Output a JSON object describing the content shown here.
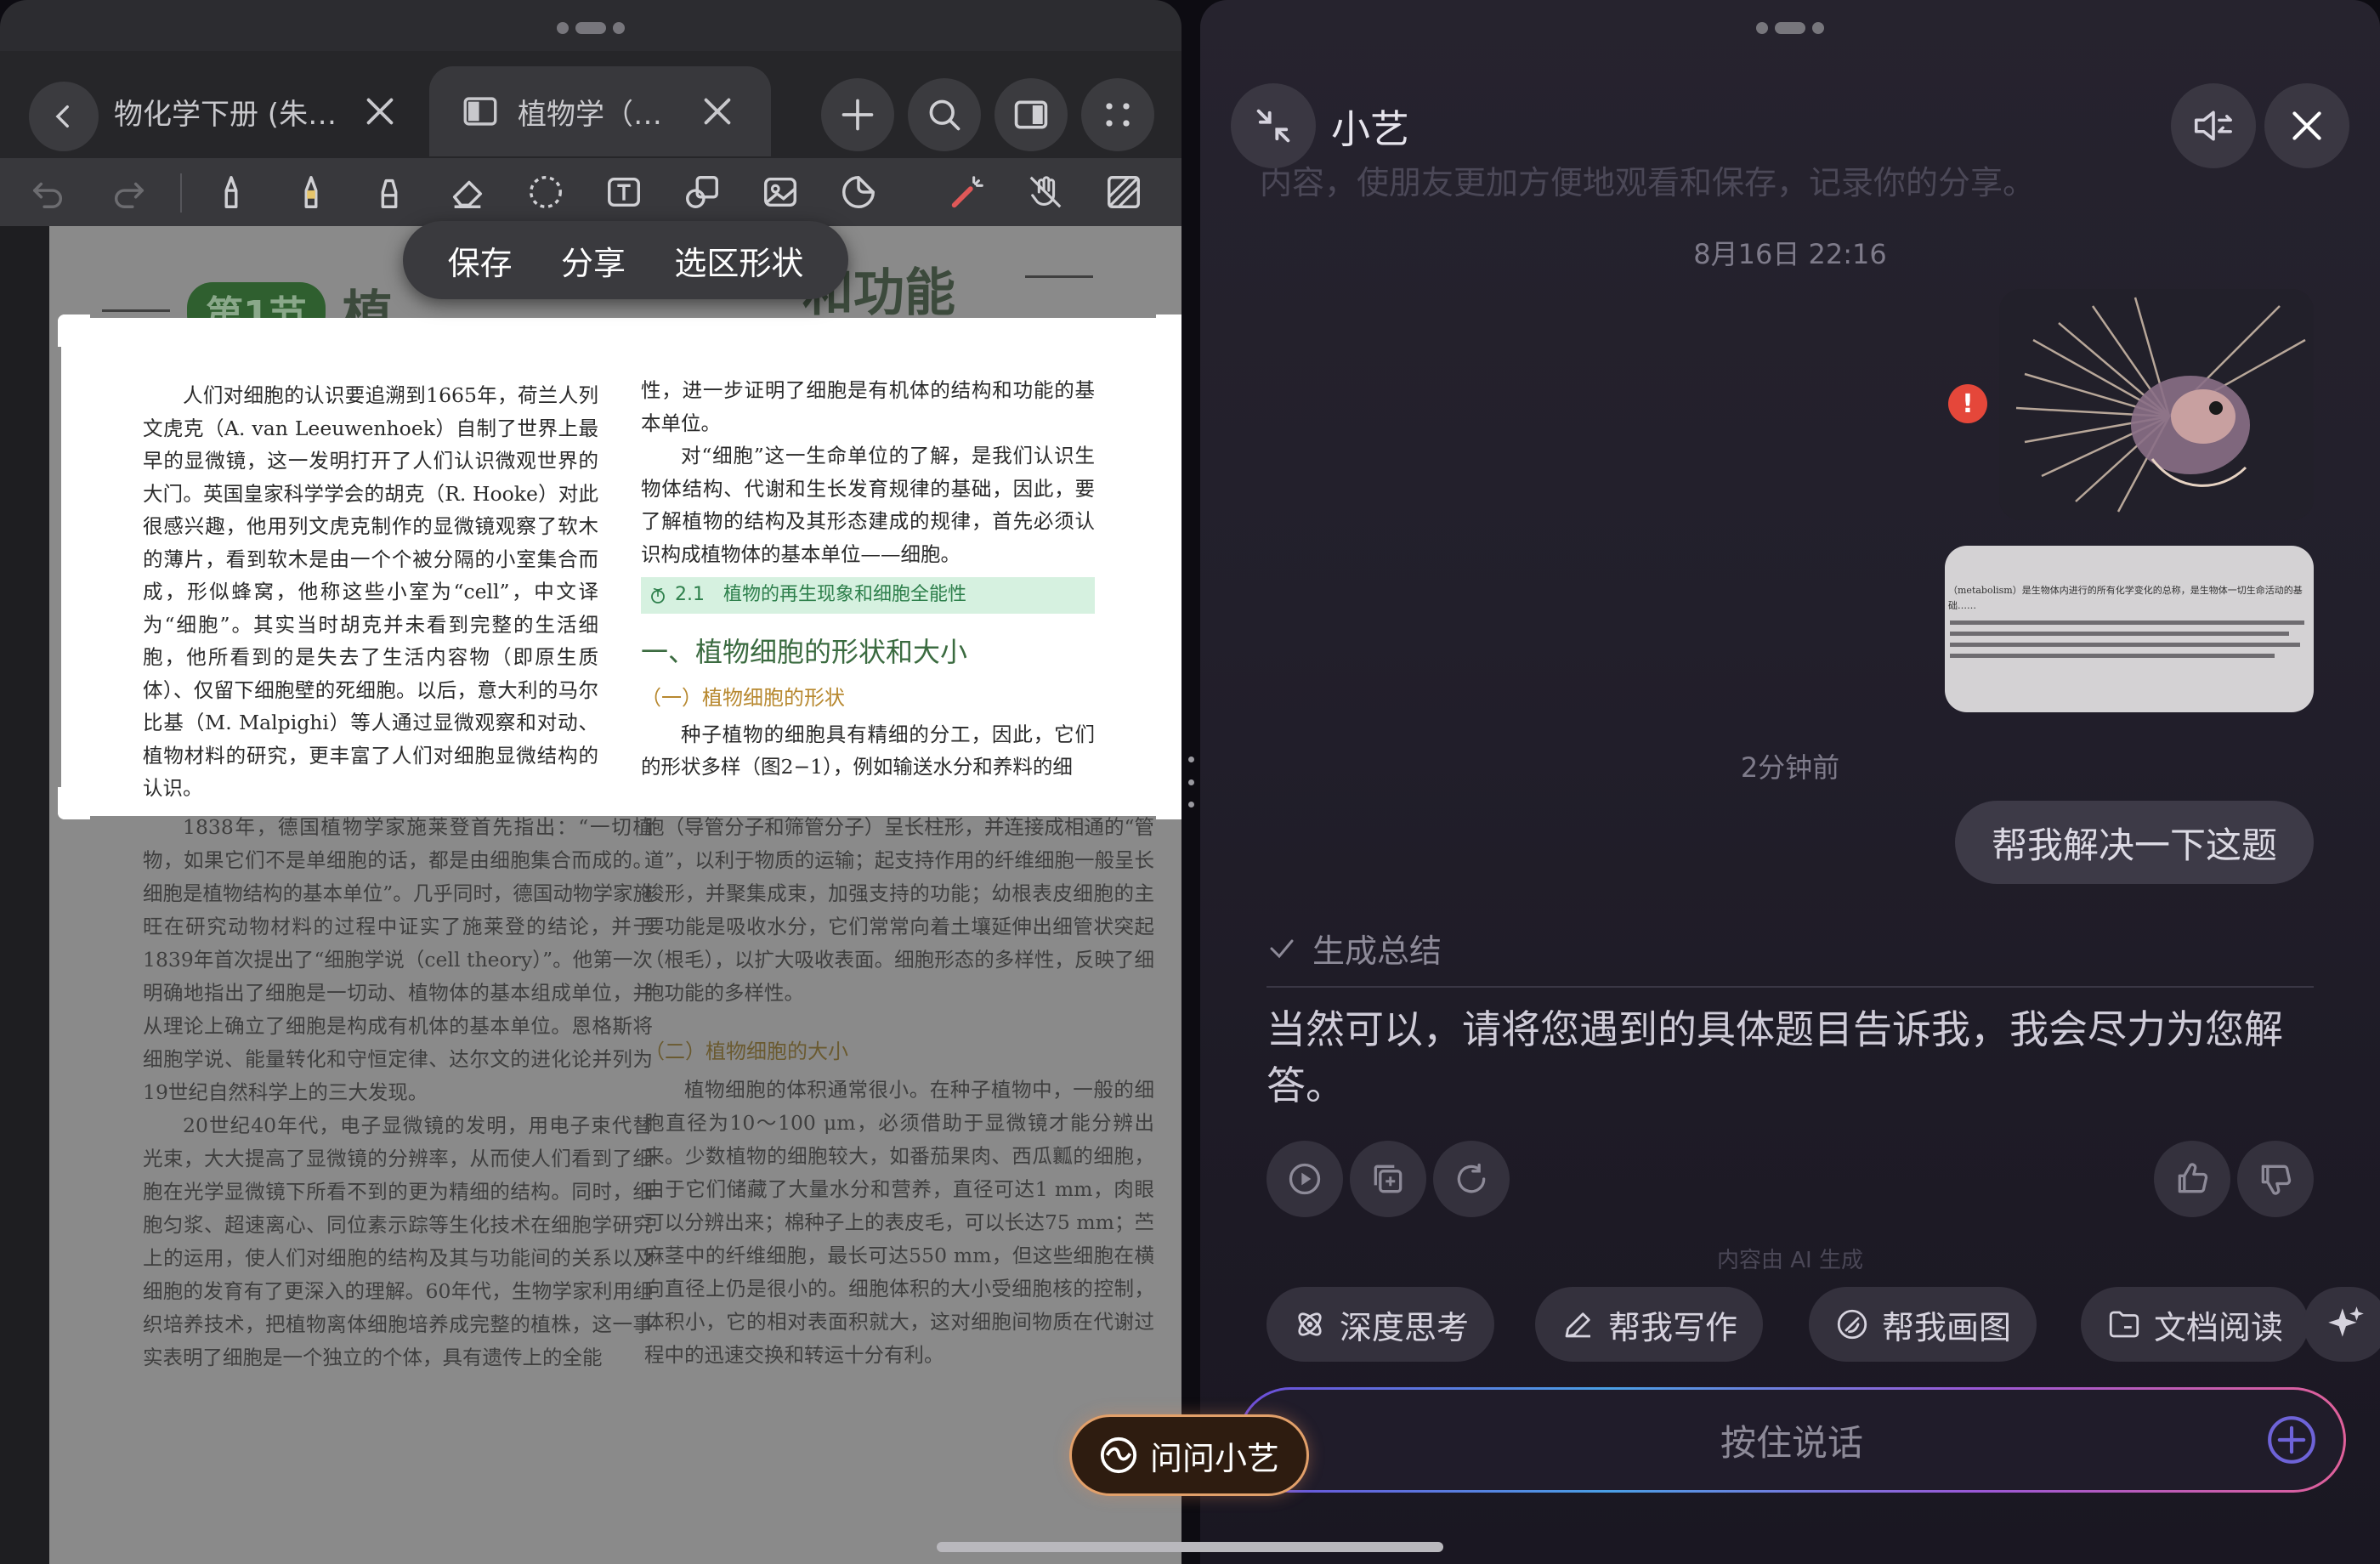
{
  "left_panel": {
    "tabs": [
      {
        "label": "物化学下册 (朱…"
      },
      {
        "label": "植物学（…"
      }
    ],
    "selection_menu": {
      "save": "保存",
      "share": "分享",
      "shape": "选区形状"
    },
    "section": {
      "badge": "第1节",
      "title_left": "植",
      "title_right": "和功能"
    },
    "selected_content": {
      "left_col": "人们对细胞的认识要追溯到1665年，荷兰人列文虎克（A. van Leeuwenhoek）自制了世界上最早的显微镜，这一发明打开了人们认识微观世界的大门。英国皇家科学学会的胡克（R. Hooke）对此很感兴趣，他用列文虎克制作的显微镜观察了软木的薄片，看到软木是由一个个被分隔的小室集合而成，形似蜂窝，他称这些小室为“cell”，中文译为“细胞”。其实当时胡克并未看到完整的生活细胞，他所看到的是失去了生活内容物（即原生质体）、仅留下细胞壁的死细胞。以后，意大利的马尔比基（M. Malpighi）等人通过显微观察和对动、植物材料的研究，更丰富了人们对细胞显微结构的认识。",
      "right_col_p1": "性，进一步证明了细胞是有机体的结构和功能的基本单位。",
      "right_col_p2": "对“细胞”这一生命单位的了解，是我们认识生物体结构、代谢和生长发育规律的基础，因此，要了解植物的结构及其形态建成的规律，首先必须认识构成植物体的基本单位——细胞。",
      "figure_ref": "2.1　植物的再生现象和细胞全能性",
      "heading": "一、植物细胞的形状和大小",
      "subheading": "（一）植物细胞的形状",
      "right_col_p3": "种子植物的细胞具有精细的分工，因此，它们的形状多样（图2−1），例如输送水分和养料的细"
    },
    "dim_content": {
      "left_p1": "1838年，德国植物学家施莱登首先指出：“一切植物，如果它们不是单细胞的话，都是由细胞集合而成的。细胞是植物结构的基本单位”。几乎同时，德国动物学家施旺在研究动物材料的过程中证实了施莱登的结论，并于1839年首次提出了“细胞学说（cell theory）”。他第一次明确地指出了细胞是一切动、植物体的基本组成单位，并从理论上确立了细胞是构成有机体的基本单位。恩格斯将细胞学说、能量转化和守恒定律、达尔文的进化论并列为19世纪自然科学上的三大发现。",
      "left_p2": "20世纪40年代，电子显微镜的发明，用电子束代替光束，大大提高了显微镜的分辨率，从而使人们看到了细胞在光学显微镜下所看不到的更为精细的结构。同时，细胞匀浆、超速离心、同位素示踪等生化技术在细胞学研究上的运用，使人们对细胞的结构及其与功能间的关系以及细胞的发育有了更深入的理解。60年代，生物学家利用组织培养技术，把植物离体细胞培养成完整的植株，这一事实表明了细胞是一个独立的个体，具有遗传上的全能",
      "right_p1": "胞（导管分子和筛管分子）呈长柱形，并连接成相通的“管道”，以利于物质的运输；起支持作用的纤维细胞一般呈长梭形，并聚集成束，加强支持的功能；幼根表皮细胞的主要功能是吸收水分，它们常常向着土壤延伸出细管状突起（根毛），以扩大吸收表面。细胞形态的多样性，反映了细胞功能的多样性。",
      "right_sub": "（二）植物细胞的大小",
      "right_p2": "植物细胞的体积通常很小。在种子植物中，一般的细胞直径为10～100 μm，必须借助于显微镜才能分辨出来。少数植物的细胞较大，如番茄果肉、西瓜瓤的细胞，由于它们储藏了大量水分和营养，直径可达1 mm，肉眼可以分辨出来；棉种子上的表皮毛，可以长达75 mm；苎麻茎中的纤维细胞，最长可达550 mm，但这些细胞在横向直径上仍是很小的。细胞体积的大小受细胞核的控制，体积小，它的相对表面积就大，这对细胞间物质在代谢过程中的迅速交换和转运十分有利。"
    },
    "ask_button": "问问小艺"
  },
  "right_panel": {
    "title": "小艺",
    "faint_line": "内容，使朋友更加方便地观看和保存，记录你的分享。",
    "timestamp1": "8月16日 22:16",
    "thumb2_text": "（metabolism）是生物体内进行的所有化学变化的总称，是生物体一切生命活动的基础……",
    "timestamp2": "2分钟前",
    "user_message": "帮我解决一下这题",
    "gen_summary": "生成总结",
    "answer": "当然可以，请将您遇到的具体题目告诉我，我会尽力为您解答。",
    "ai_note": "内容由 AI 生成",
    "chips": [
      {
        "label": "深度思考",
        "icon": "atom-icon"
      },
      {
        "label": "帮我写作",
        "icon": "pen-icon"
      },
      {
        "label": "帮我画图",
        "icon": "brush-icon"
      },
      {
        "label": "文档阅读",
        "icon": "folder-icon"
      }
    ],
    "input_placeholder": "按住说话"
  },
  "colors": {
    "accent_green": "#3b6b40",
    "figure_ref_bg": "#d6f1e0",
    "error_red": "#e5473a",
    "ask_border": "#e2a06a"
  }
}
